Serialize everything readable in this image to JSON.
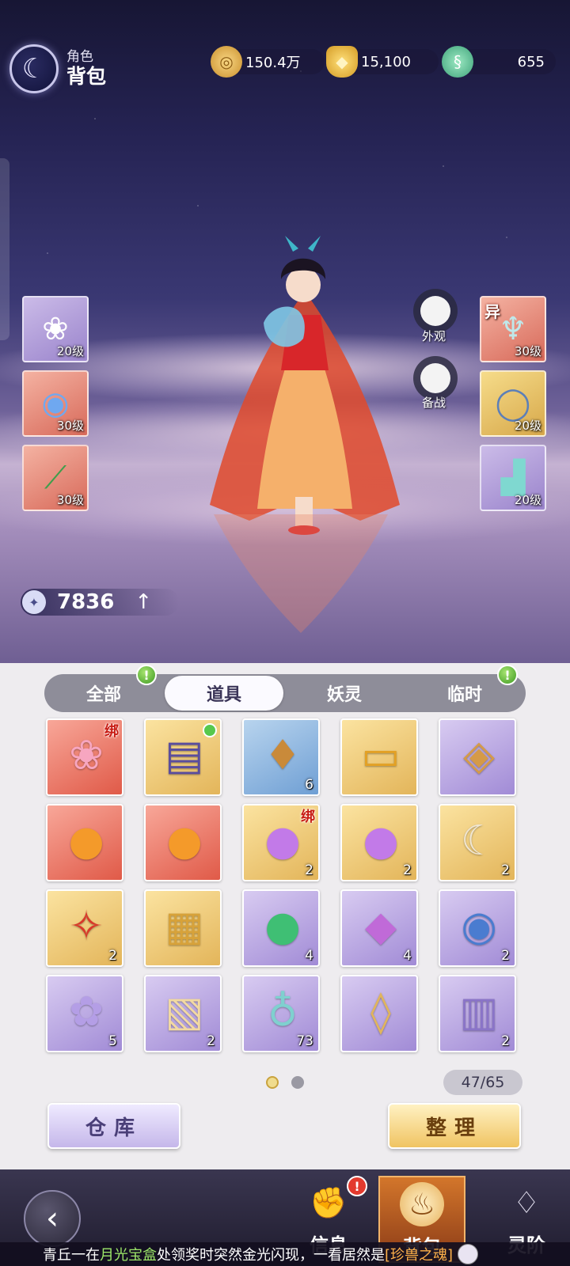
{
  "header": {
    "subtitle": "角色",
    "title": "背包",
    "icon": "crescent-moon-icon"
  },
  "currencies": [
    {
      "name": "copper-coin-icon",
      "value": "150.4万"
    },
    {
      "name": "gold-ingot-icon",
      "value": "15,100"
    },
    {
      "name": "jade-dragon-icon",
      "value": "655"
    }
  ],
  "equipment_left": [
    {
      "icon": "folding-fan-icon",
      "level": "20级",
      "rarity": "purple"
    },
    {
      "icon": "jade-pendant-icon",
      "level": "30级",
      "rarity": "red"
    },
    {
      "icon": "bamboo-flute-icon",
      "level": "30级",
      "rarity": "red"
    }
  ],
  "equipment_right": [
    {
      "icon": "robe-icon",
      "level": "30级",
      "rarity": "red",
      "tag": "异"
    },
    {
      "icon": "ring-icon",
      "level": "20级",
      "rarity": "gold"
    },
    {
      "icon": "boots-icon",
      "level": "20级",
      "rarity": "purple"
    }
  ],
  "side_buttons": {
    "appearance": "外观",
    "standby": "备战"
  },
  "power": {
    "value": "7836"
  },
  "tabs": [
    {
      "label": "全部",
      "active": false,
      "badge": true
    },
    {
      "label": "道具",
      "active": true,
      "badge": false
    },
    {
      "label": "妖灵",
      "active": false,
      "badge": false
    },
    {
      "label": "临时",
      "active": false,
      "badge": true
    }
  ],
  "items": [
    {
      "icon": "lotus-flower-icon",
      "rarity": "red",
      "count": "",
      "bind": "绑"
    },
    {
      "icon": "gift-book-icon",
      "rarity": "gold",
      "count": "",
      "dot": true
    },
    {
      "icon": "lucky-bag-icon",
      "rarity": "blue",
      "count": "6"
    },
    {
      "icon": "discount-card-icon",
      "rarity": "gold",
      "count": ""
    },
    {
      "icon": "fate-token-icon",
      "rarity": "purple",
      "count": ""
    },
    {
      "icon": "beast-orb-icon",
      "rarity": "red",
      "count": ""
    },
    {
      "icon": "beast-orb-icon",
      "rarity": "red",
      "count": ""
    },
    {
      "icon": "rainbow-peach-icon",
      "rarity": "gold",
      "count": "2",
      "bind": "绑"
    },
    {
      "icon": "rainbow-peach-icon",
      "rarity": "gold",
      "count": "2"
    },
    {
      "icon": "beast-claw-icon",
      "rarity": "gold",
      "count": "2"
    },
    {
      "icon": "phoenix-feather-icon",
      "rarity": "gold",
      "count": "2"
    },
    {
      "icon": "gold-ingots-icon",
      "rarity": "gold",
      "count": ""
    },
    {
      "icon": "jade-orb-icon",
      "rarity": "purple",
      "count": "4"
    },
    {
      "icon": "crystal-gem-icon",
      "rarity": "purple",
      "count": "4"
    },
    {
      "icon": "cultivation-orb-icon",
      "rarity": "purple",
      "count": "2"
    },
    {
      "icon": "spirit-lotus-icon",
      "rarity": "purple",
      "count": "5"
    },
    {
      "icon": "scroll-card-icon",
      "rarity": "purple",
      "count": "2"
    },
    {
      "icon": "potion-bottle-icon",
      "rarity": "purple",
      "count": "73"
    },
    {
      "icon": "imperial-token-icon",
      "rarity": "purple",
      "count": ""
    },
    {
      "icon": "spell-book-icon",
      "rarity": "purple",
      "count": "2"
    }
  ],
  "capacity": "47/65",
  "buttons": {
    "storage": "仓库",
    "sort": "整理"
  },
  "nav": [
    {
      "label": "信息",
      "icon": "fist-icon",
      "active": false
    },
    {
      "label": "背包",
      "icon": "bag-icon",
      "active": true
    },
    {
      "label": "灵阶",
      "icon": "flame-icon",
      "active": false
    }
  ],
  "ticker": {
    "p1": "青丘一在",
    "p2": "月光宝盒",
    "p3": "处领奖时突然金光闪现，一看居然是",
    "p4": "[珍兽之魂]"
  },
  "colors": {
    "accent_gold": "#f0c462",
    "accent_purple": "#a18bd6",
    "accent_red": "#e05a48",
    "badge_green": "#3e9a23"
  }
}
